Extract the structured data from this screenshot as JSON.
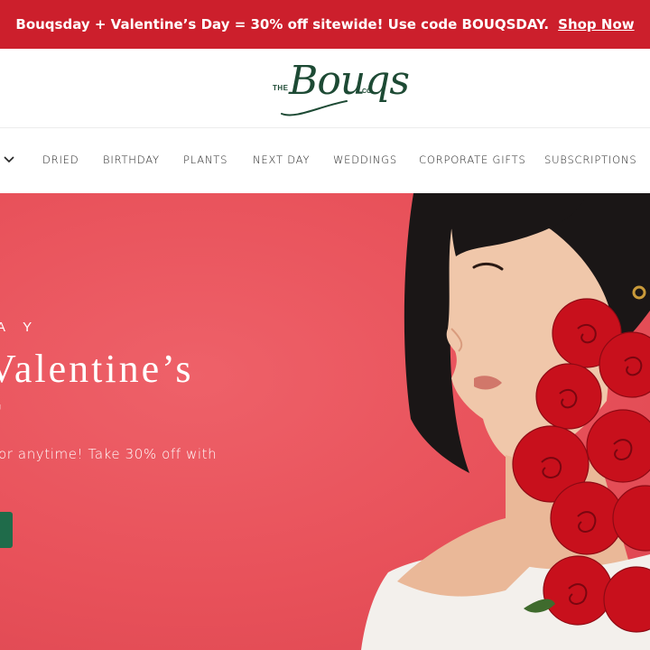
{
  "promo": {
    "text": "Bouqsday + Valentine’s Day = 30% off sitewide! Use code BOUQSDAY.",
    "link_label": "Shop Now"
  },
  "header": {
    "logo": {
      "prefix": "THE",
      "wordmark": "Bouqs",
      "suffix": "CO."
    }
  },
  "nav": {
    "items": [
      {
        "label": "DRIED"
      },
      {
        "label": "BIRTHDAY"
      },
      {
        "label": "PLANTS"
      },
      {
        "label": "NEXT DAY"
      },
      {
        "label": "WEDDINGS"
      },
      {
        "label": "CORPORATE GIFTS"
      },
      {
        "label": "SUBSCRIPTIONS"
      }
    ]
  },
  "hero": {
    "eyebrow": "A Y",
    "title_line1": "Valentine’s",
    "title_line2": "r",
    "subtitle": "or anytime! Take 30% off with"
  },
  "colors": {
    "promo_bg": "#cc1f2c",
    "hero_bg": "#e8515a",
    "brand_green": "#1d4a34",
    "cta_green": "#1f6b4a",
    "rose_red": "#c8101c"
  },
  "icons": {
    "nav_dropdown": "chevron-down-icon"
  }
}
